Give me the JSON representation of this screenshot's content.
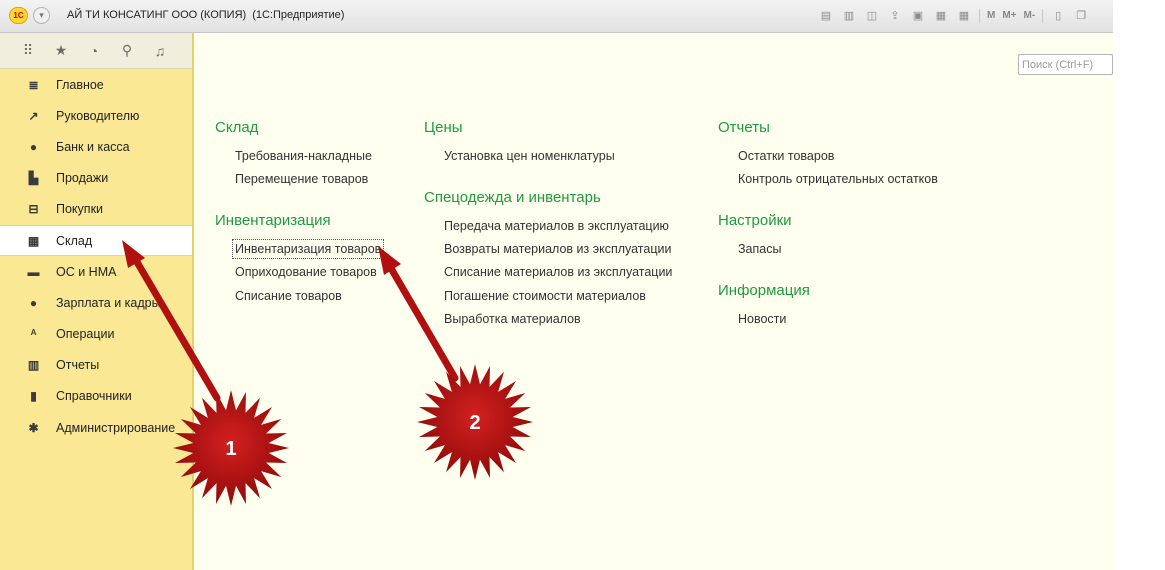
{
  "window": {
    "logo": "1С",
    "title": "АЙ ТИ КОНСАТИНГ ООО (КОПИЯ)",
    "subtitle": "(1С:Предприятие)",
    "toolbar_memory": [
      "M",
      "M+",
      "M-"
    ]
  },
  "sidebar": {
    "top_icons": [
      "apps-grid-icon",
      "star-icon",
      "history-icon",
      "search-icon",
      "bell-icon"
    ],
    "items": [
      {
        "label": "Главное",
        "icon": "≣"
      },
      {
        "label": "Руководителю",
        "icon": "↗"
      },
      {
        "label": "Банк и касса",
        "icon": "●"
      },
      {
        "label": "Продажи",
        "icon": "▙"
      },
      {
        "label": "Покупки",
        "icon": "⊟"
      },
      {
        "label": "Склад",
        "icon": "▦"
      },
      {
        "label": "ОС и НМА",
        "icon": "▬"
      },
      {
        "label": "Зарплата и кадры",
        "icon": "●"
      },
      {
        "label": "Операции",
        "icon": "ᴬ"
      },
      {
        "label": "Отчеты",
        "icon": "▥"
      },
      {
        "label": "Справочники",
        "icon": "▮"
      },
      {
        "label": "Администрирование",
        "icon": "✱"
      }
    ],
    "active_item": "Склад"
  },
  "search": {
    "placeholder": "Поиск (Ctrl+F)",
    "value": ""
  },
  "sections": {
    "sklad": {
      "title": "Склад",
      "links": [
        "Требования-накладные",
        "Перемещение товаров"
      ]
    },
    "inventarizatsiya": {
      "title": "Инвентаризация",
      "links": [
        "Инвентаризация товаров",
        "Оприходование товаров",
        "Списание товаров"
      ]
    },
    "tseny": {
      "title": "Цены",
      "links": [
        "Установка цен номенклатуры"
      ]
    },
    "spetsodezhda": {
      "title": "Спецодежда и инвентарь",
      "links": [
        "Передача материалов в эксплуатацию",
        "Возвраты материалов из эксплуатации",
        "Списание материалов из эксплуатации",
        "Погашение стоимости материалов",
        "Выработка материалов"
      ]
    },
    "otchety": {
      "title": "Отчеты",
      "links": [
        "Остатки товаров",
        "Контроль отрицательных остатков"
      ]
    },
    "nastroyki": {
      "title": "Настройки",
      "links": [
        "Запасы"
      ]
    },
    "informatsiya": {
      "title": "Информация",
      "links": [
        "Новости"
      ]
    }
  },
  "annotations": {
    "badge_1": "1",
    "badge_2": "2",
    "color": "#b01010"
  }
}
